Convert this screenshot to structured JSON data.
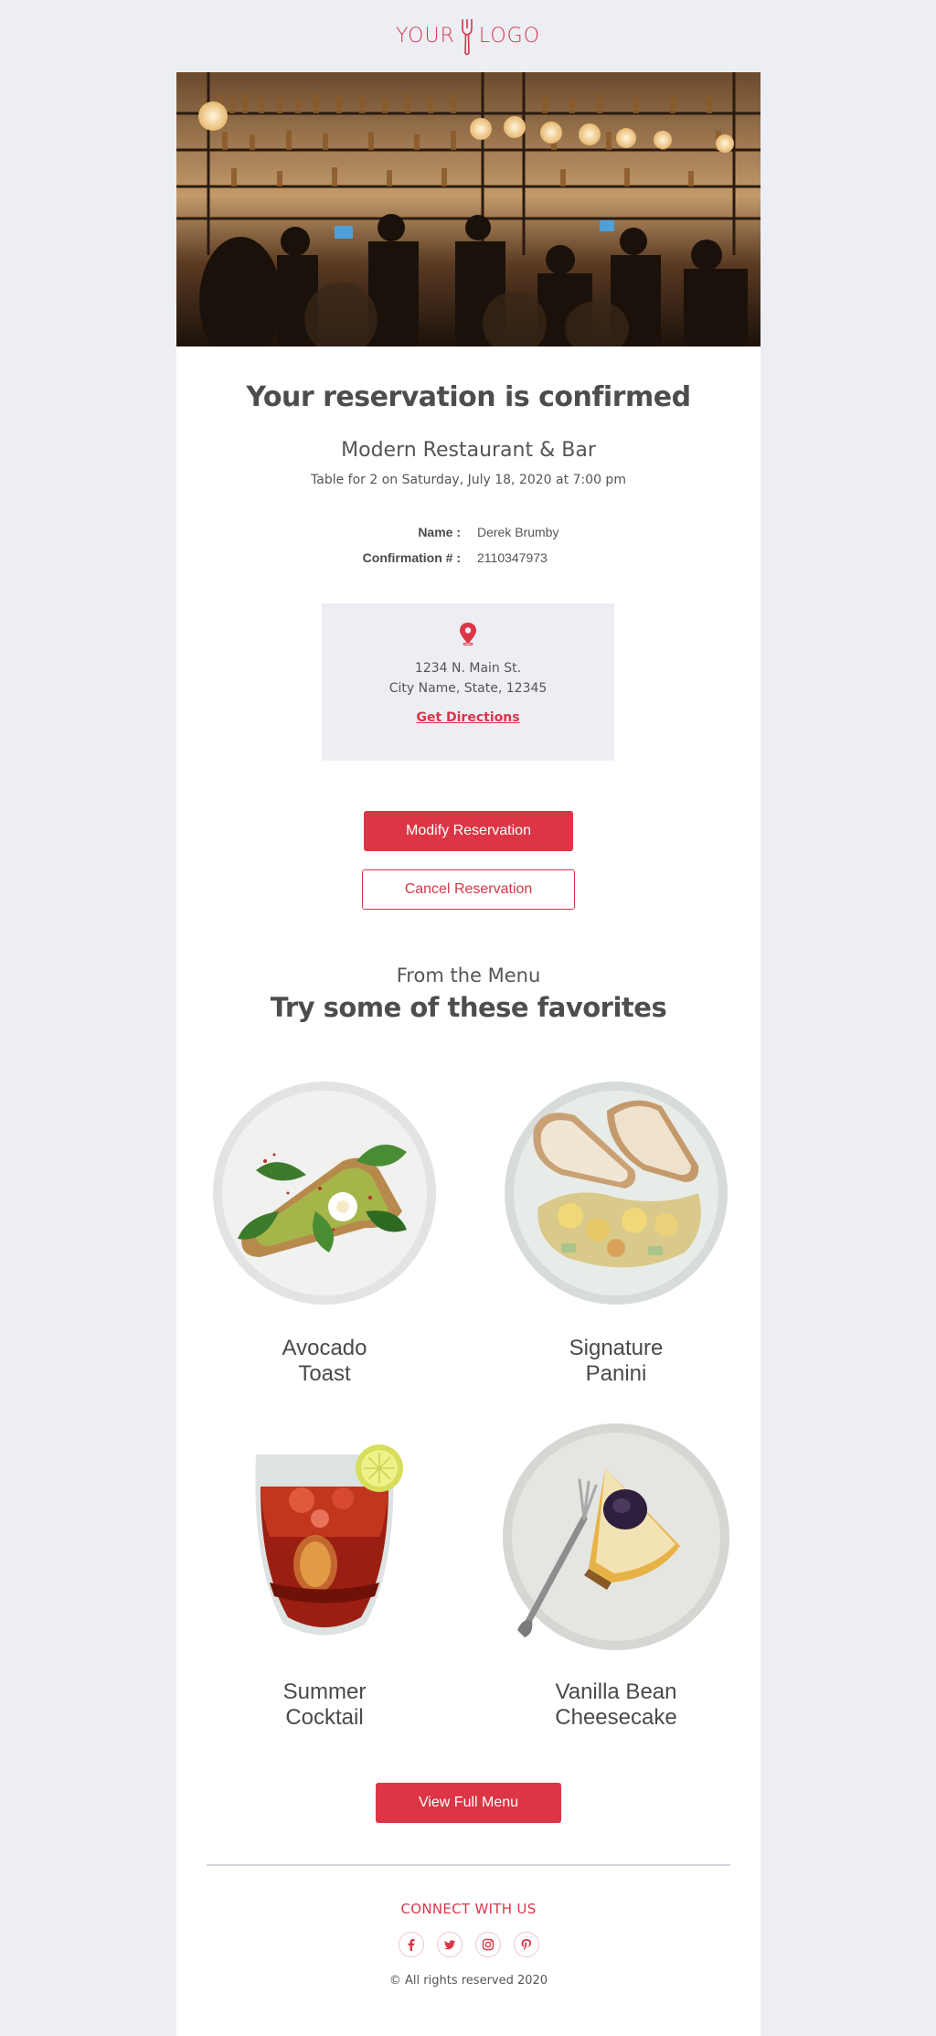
{
  "logo": {
    "left_word": "YOUR",
    "right_word": "LOGO",
    "icon": "fork-icon",
    "color": "#d7374a"
  },
  "hero": {
    "alt": "restaurant-bar-photo"
  },
  "confirmation": {
    "title": "Your reservation is confirmed",
    "restaurant": "Modern Restaurant & Bar",
    "table_line": "Table for 2 on Saturday, July 18, 2020 at 7:00 pm",
    "name_label": "Name :",
    "name_value": "Derek Brumby",
    "conf_label": "Confirmation # :",
    "conf_value": "2110347973"
  },
  "address": {
    "icon": "map-pin-icon",
    "line1": "1234 N. Main St.",
    "line2": "City Name, State, 12345",
    "directions_label": "Get Directions"
  },
  "actions": {
    "modify_label": "Modify Reservation",
    "cancel_label": "Cancel Reservation"
  },
  "menu": {
    "subtitle": "From the Menu",
    "title": "Try some of these favorites",
    "items": [
      {
        "name_line1": "Avocado",
        "name_line2": "Toast"
      },
      {
        "name_line1": "Signature",
        "name_line2": "Panini"
      },
      {
        "name_line1": "Summer",
        "name_line2": "Cocktail"
      },
      {
        "name_line1": "Vanilla Bean",
        "name_line2": "Cheesecake"
      }
    ],
    "full_menu_label": "View Full Menu"
  },
  "footer": {
    "connect": "CONNECT WITH US",
    "socials": [
      "facebook-icon",
      "twitter-icon",
      "instagram-icon",
      "pinterest-icon"
    ],
    "copyright": "© All rights reserved 2020"
  },
  "colors": {
    "accent": "#dc3545",
    "background": "#edeef3"
  }
}
